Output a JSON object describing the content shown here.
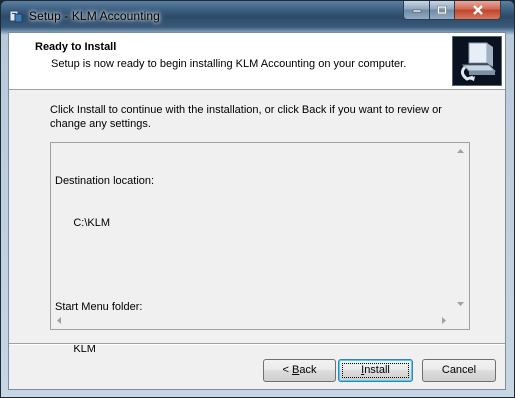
{
  "window": {
    "title": "Setup - KLM Accounting"
  },
  "header": {
    "title": "Ready to Install",
    "subtitle": "Setup is now ready to begin installing KLM Accounting on your computer."
  },
  "intro": "Click Install to continue with the installation, or click Back if you want to review or change any settings.",
  "memo": {
    "lines": [
      "Destination location:",
      "      C:\\KLM",
      "",
      "Start Menu folder:",
      "      KLM"
    ]
  },
  "buttons": {
    "back": "< Back",
    "back_accel": "B",
    "install": "Install",
    "install_accel": "I",
    "cancel": "Cancel"
  },
  "icons": {
    "app": "setup-icon",
    "wizard": "computer-install-icon",
    "minimize": "minimize-icon",
    "maximize": "maximize-icon",
    "close": "close-icon"
  }
}
